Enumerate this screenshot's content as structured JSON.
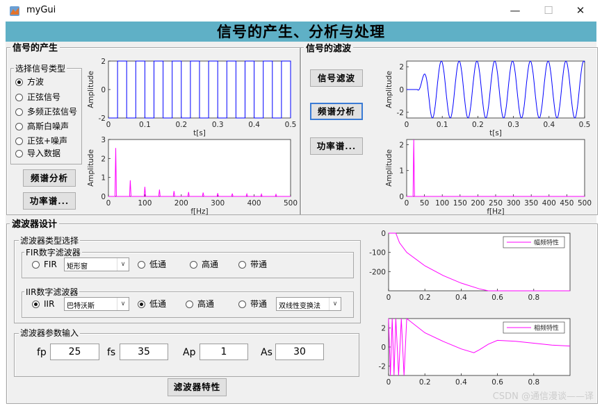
{
  "window": {
    "title": "myGui",
    "minimize": "—",
    "maximize": "☐",
    "close": "✕"
  },
  "banner": {
    "title": "信号的产生、分析与处理"
  },
  "gen": {
    "legend": "信号的产生",
    "type_group": {
      "legend": "选择信号类型",
      "options": [
        "方波",
        "正弦信号",
        "多频正弦信号",
        "高斯白噪声",
        "正弦+噪声",
        "导入数据"
      ],
      "selected": 0
    },
    "spectrum_button": "频谱分析",
    "power_button": "功率谱..."
  },
  "filt": {
    "legend": "信号的滤波",
    "filter_button": "信号滤波",
    "spectrum_button": "频谱分析",
    "power_button": "功率谱..."
  },
  "design": {
    "legend": "滤波器设计",
    "type_legend": "滤波器类型选择",
    "fir": {
      "legend": "FIR数字滤波器",
      "radio": "FIR",
      "window": "矩形窗",
      "low": "低通",
      "high": "高通",
      "band": "带通"
    },
    "iir": {
      "legend": "IIR数字滤波器",
      "radio": "IIR",
      "proto": "巴特沃斯",
      "low": "低通",
      "high": "高通",
      "band": "带通",
      "method": "双线性变换法"
    },
    "param_legend": "滤波器参数输入",
    "params": {
      "fp_label": "fp",
      "fp": "25",
      "fs_label": "fs",
      "fs": "35",
      "ap_label": "Ap",
      "ap": "1",
      "as_label": "As",
      "as": "30"
    },
    "char_button": "滤波器特性"
  },
  "colors": {
    "banner": "#5fb0c6",
    "blue": "#0000ff",
    "magenta": "#ff00ff",
    "panel": "#f0f0f0"
  },
  "chart_data": [
    {
      "type": "line",
      "id": "gen-time",
      "xlabel": "t[s]",
      "ylabel": "Amplitude",
      "xlim": [
        0,
        0.5
      ],
      "ylim": [
        -2,
        2
      ],
      "xticks": [
        "0",
        "0.1",
        "0.2",
        "0.3",
        "0.4",
        "0.5"
      ],
      "yticks": [
        "-2",
        "0",
        "2"
      ],
      "series": [
        {
          "signal": "square",
          "frequency_hz": 20,
          "amplitude": 2
        }
      ]
    },
    {
      "type": "line",
      "id": "gen-spectrum",
      "xlabel": "f[Hz]",
      "ylabel": "Amplitude",
      "xlim": [
        0,
        500
      ],
      "ylim": [
        0,
        3
      ],
      "xticks": [
        "0",
        "100",
        "200",
        "300",
        "400",
        "500"
      ],
      "yticks": [
        "0",
        "1",
        "2",
        "3"
      ],
      "series": [
        {
          "peaks": [
            [
              20,
              2.55
            ],
            [
              60,
              0.85
            ],
            [
              100,
              0.51
            ],
            [
              140,
              0.36
            ],
            [
              180,
              0.28
            ],
            [
              220,
              0.23
            ],
            [
              260,
              0.2
            ],
            [
              300,
              0.17
            ],
            [
              340,
              0.15
            ],
            [
              380,
              0.13
            ],
            [
              420,
              0.12
            ],
            [
              460,
              0.11
            ]
          ]
        }
      ]
    },
    {
      "type": "line",
      "id": "filt-time",
      "xlabel": "t[s]",
      "ylabel": "Amplitude",
      "xlim": [
        0,
        0.5
      ],
      "ylim": [
        -2.5,
        2.5
      ],
      "xticks": [
        "0",
        "0.1",
        "0.2",
        "0.3",
        "0.4",
        "0.5"
      ],
      "yticks": [
        "-2",
        "0",
        "2"
      ],
      "series": [
        {
          "signal": "filtered sine",
          "frequency_hz": 20,
          "amplitude": 2.5
        }
      ]
    },
    {
      "type": "line",
      "id": "filt-spectrum",
      "xlabel": "f[Hz]",
      "ylabel": "Amplitude",
      "xlim": [
        0,
        500
      ],
      "ylim": [
        0,
        2.2
      ],
      "xticks": [
        "0",
        "50",
        "100",
        "150",
        "200",
        "250",
        "300",
        "350",
        "400",
        "450",
        "500"
      ],
      "yticks": [
        "0",
        "1",
        "2"
      ],
      "series": [
        {
          "peaks": [
            [
              20,
              2.2
            ]
          ]
        }
      ]
    },
    {
      "type": "line",
      "id": "mag-resp",
      "xlim": [
        0,
        1
      ],
      "ylim": [
        -300,
        0
      ],
      "xticks": [
        "0",
        "0.2",
        "0.4",
        "0.6",
        "0.8"
      ],
      "yticks": [
        "0",
        "-100",
        "-200"
      ],
      "series": [
        {
          "name": "幅频特性",
          "x": [
            0,
            0.04,
            0.06,
            0.1,
            0.2,
            0.3,
            0.4,
            0.5,
            0.55,
            0.6,
            1.0
          ],
          "y": [
            0,
            0,
            -50,
            -100,
            -170,
            -220,
            -260,
            -290,
            -300,
            -300,
            -300
          ]
        }
      ]
    },
    {
      "type": "line",
      "id": "phase-resp",
      "xlim": [
        0,
        1
      ],
      "ylim": [
        -3,
        3
      ],
      "xticks": [
        "0",
        "0.2",
        "0.4",
        "0.6",
        "0.8"
      ],
      "yticks": [
        "2",
        "0",
        "-2"
      ],
      "series": [
        {
          "name": "相频特性",
          "x": [
            0.1,
            0.2,
            0.3,
            0.4,
            0.47,
            0.5,
            0.55,
            0.6,
            0.7,
            0.8,
            0.9,
            1.0
          ],
          "y": [
            3,
            1.5,
            0.6,
            -0.2,
            -0.6,
            -0.3,
            0.3,
            0.7,
            0.6,
            0.4,
            0.2,
            0.1
          ]
        }
      ]
    }
  ]
}
